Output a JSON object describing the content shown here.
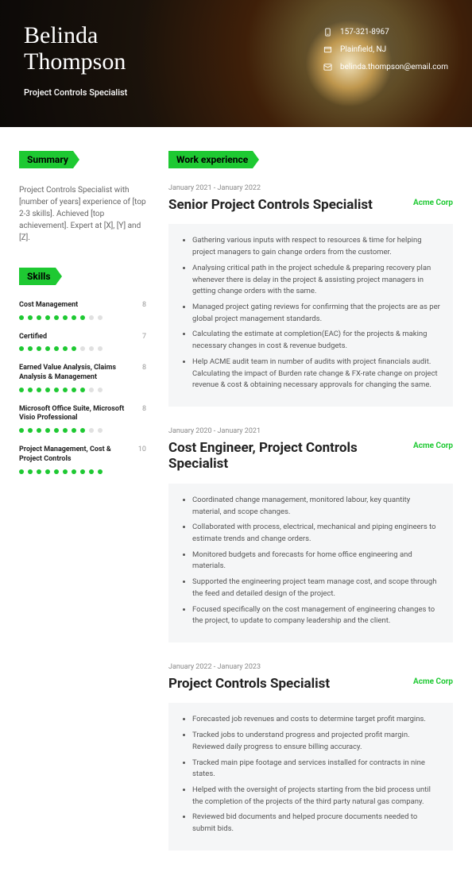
{
  "header": {
    "first_name": "Belinda",
    "last_name": "Thompson",
    "title": "Project Controls Specialist",
    "phone": "157-321-8967",
    "location": "Plainfield, NJ",
    "email": "belinda.thompson@email.com"
  },
  "sections": {
    "summary": "Summary",
    "skills": "Skills",
    "work": "Work experience"
  },
  "summary": "Project Controls Specialist with [number of years] experience of [top 2-3 skills]. Achieved [top achievement]. Expert at [X], [Y] and [Z].",
  "skills": [
    {
      "name": "Cost Management",
      "score": 8
    },
    {
      "name": "Certified",
      "score": 7
    },
    {
      "name": "Earned Value Analysis, Claims Analysis & Management",
      "score": 8
    },
    {
      "name": "Microsoft Office Suite, Microsoft Visio Professional",
      "score": 8
    },
    {
      "name": "Project Management, Cost & Project Controls",
      "score": 10
    }
  ],
  "jobs": [
    {
      "dates": "January 2021 - January 2022",
      "title": "Senior Project Controls Specialist",
      "company": "Acme Corp",
      "bullets": [
        "Gathering various inputs with respect to resources & time for helping project managers to gain change orders from the customer.",
        "Analysing critical path in the project schedule & preparing recovery plan whenever there is delay in the project & assisting project managers in getting change orders with the same.",
        "Managed project gating reviews for confirming that the projects are as per global project management standards.",
        "Calculating the estimate at completion(EAC) for the projects & making necessary changes in cost & revenue budgets.",
        "Help ACME audit team in number of audits with project financials audit. Calculating the impact of Burden rate change & FX-rate change on project revenue & cost & obtaining necessary approvals for changing the same."
      ]
    },
    {
      "dates": "January 2020 - January 2021",
      "title": "Cost Engineer, Project Controls Specialist",
      "company": "Acme Corp",
      "bullets": [
        "Coordinated change management, monitored labour, key quantity material, and scope changes.",
        "Collaborated with process, electrical, mechanical and piping engineers to estimate trends and change orders.",
        "Monitored budgets and forecasts for home office engineering and materials.",
        "Supported the engineering project team manage cost, and scope through the feed and detailed design of the project.",
        "Focused specifically on the cost management of engineering changes to the project, to update to company leadership and the client."
      ]
    },
    {
      "dates": "January 2022 - January 2023",
      "title": "Project Controls Specialist",
      "company": "Acme Corp",
      "bullets": [
        "Forecasted job revenues and costs to determine target profit margins.",
        "Tracked jobs to understand progress and projected profit margin. Reviewed daily progress to ensure billing accuracy.",
        "Tracked main pipe footage and services installed for contracts in nine states.",
        "Helped with the oversight of projects starting from the bid process until the completion of the projects of the third party natural gas company.",
        "Reviewed bid documents and helped procure documents needed to submit bids."
      ]
    }
  ]
}
